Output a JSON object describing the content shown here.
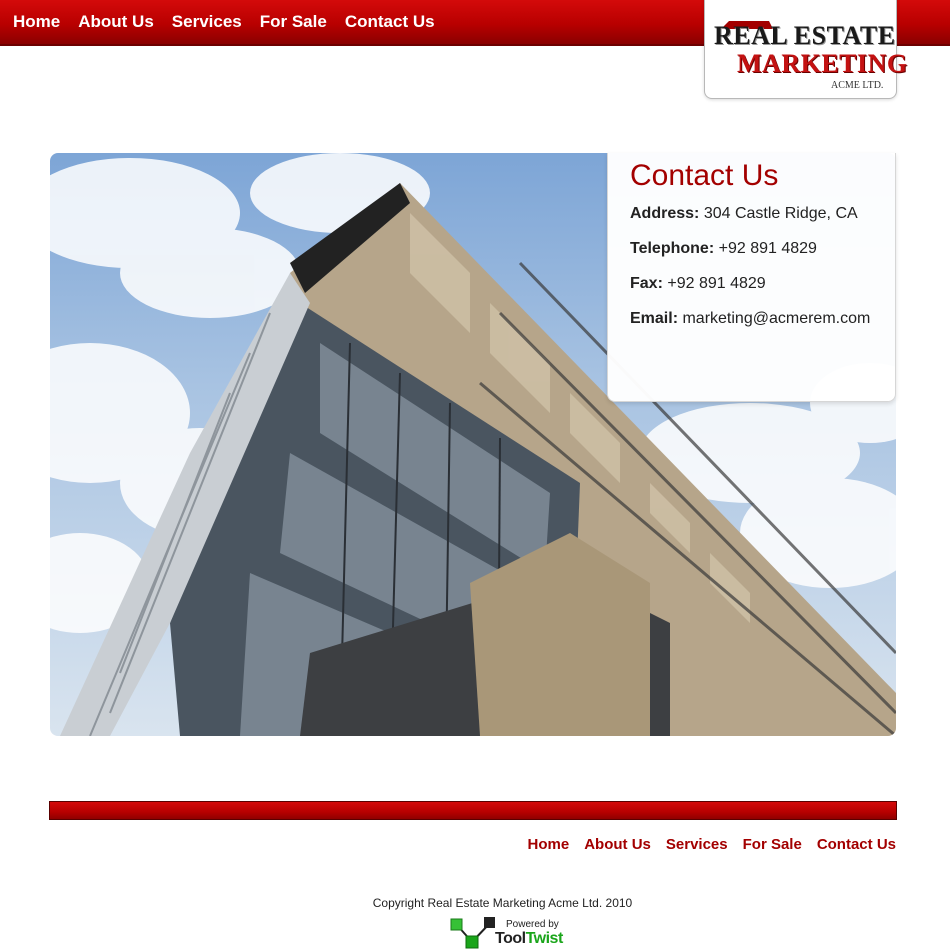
{
  "header": {
    "nav": [
      "Home",
      "About Us",
      "Services",
      "For Sale",
      "Contact Us"
    ]
  },
  "logo": {
    "line1": "REAL ESTATE",
    "line2": "MARKETING",
    "line3": "ACME LTD."
  },
  "contact": {
    "title": "Contact Us",
    "address_label": "Address:",
    "address": "304 Castle Ridge, CA",
    "telephone_label": "Telephone:",
    "telephone": "+92 891 4829",
    "fax_label": "Fax:",
    "fax": "+92 891 4829",
    "email_label": "Email:",
    "email": "marketing@acmerem.com"
  },
  "footer": {
    "nav": [
      "Home",
      "About Us",
      "Services",
      "For Sale",
      "Contact Us"
    ],
    "copyright": "Copyright Real Estate Marketing Acme Ltd. 2010",
    "powered_by": "Powered by",
    "powered_brand_a": "Tool",
    "powered_brand_b": "Twist"
  },
  "colors": {
    "brand_red": "#b80000",
    "link_red": "#a30000",
    "sky": "#7da5d6",
    "tooltwist_green": "#1aa51a"
  }
}
